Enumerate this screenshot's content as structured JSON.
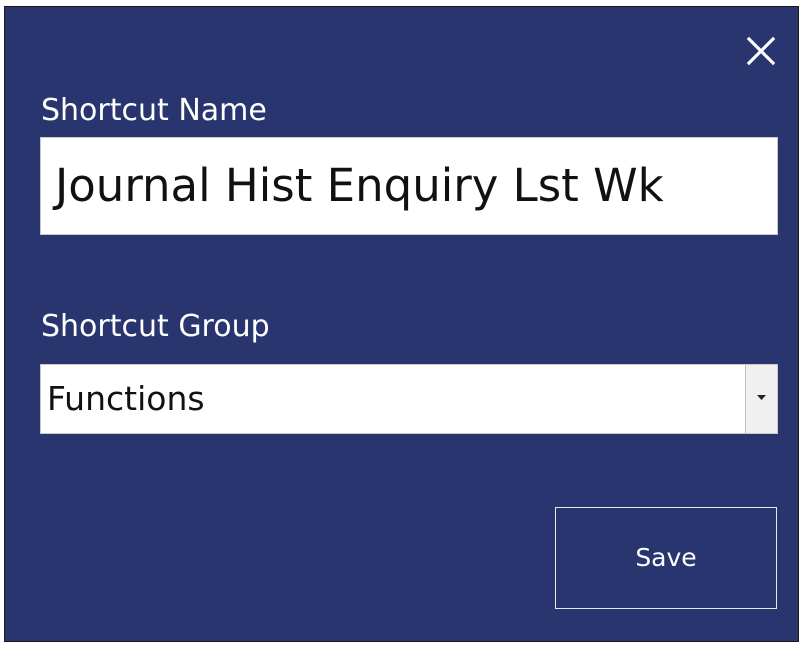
{
  "dialog": {
    "background_color": "#28356f",
    "close_icon": "close-icon"
  },
  "fields": {
    "shortcut_name_label": "Shortcut Name",
    "shortcut_name_value": "Journal Hist Enquiry Lst Wk",
    "shortcut_group_label": "Shortcut Group",
    "shortcut_group_value": "Functions",
    "dropdown_icon": "chevron-down-icon"
  },
  "actions": {
    "save_label": "Save"
  }
}
